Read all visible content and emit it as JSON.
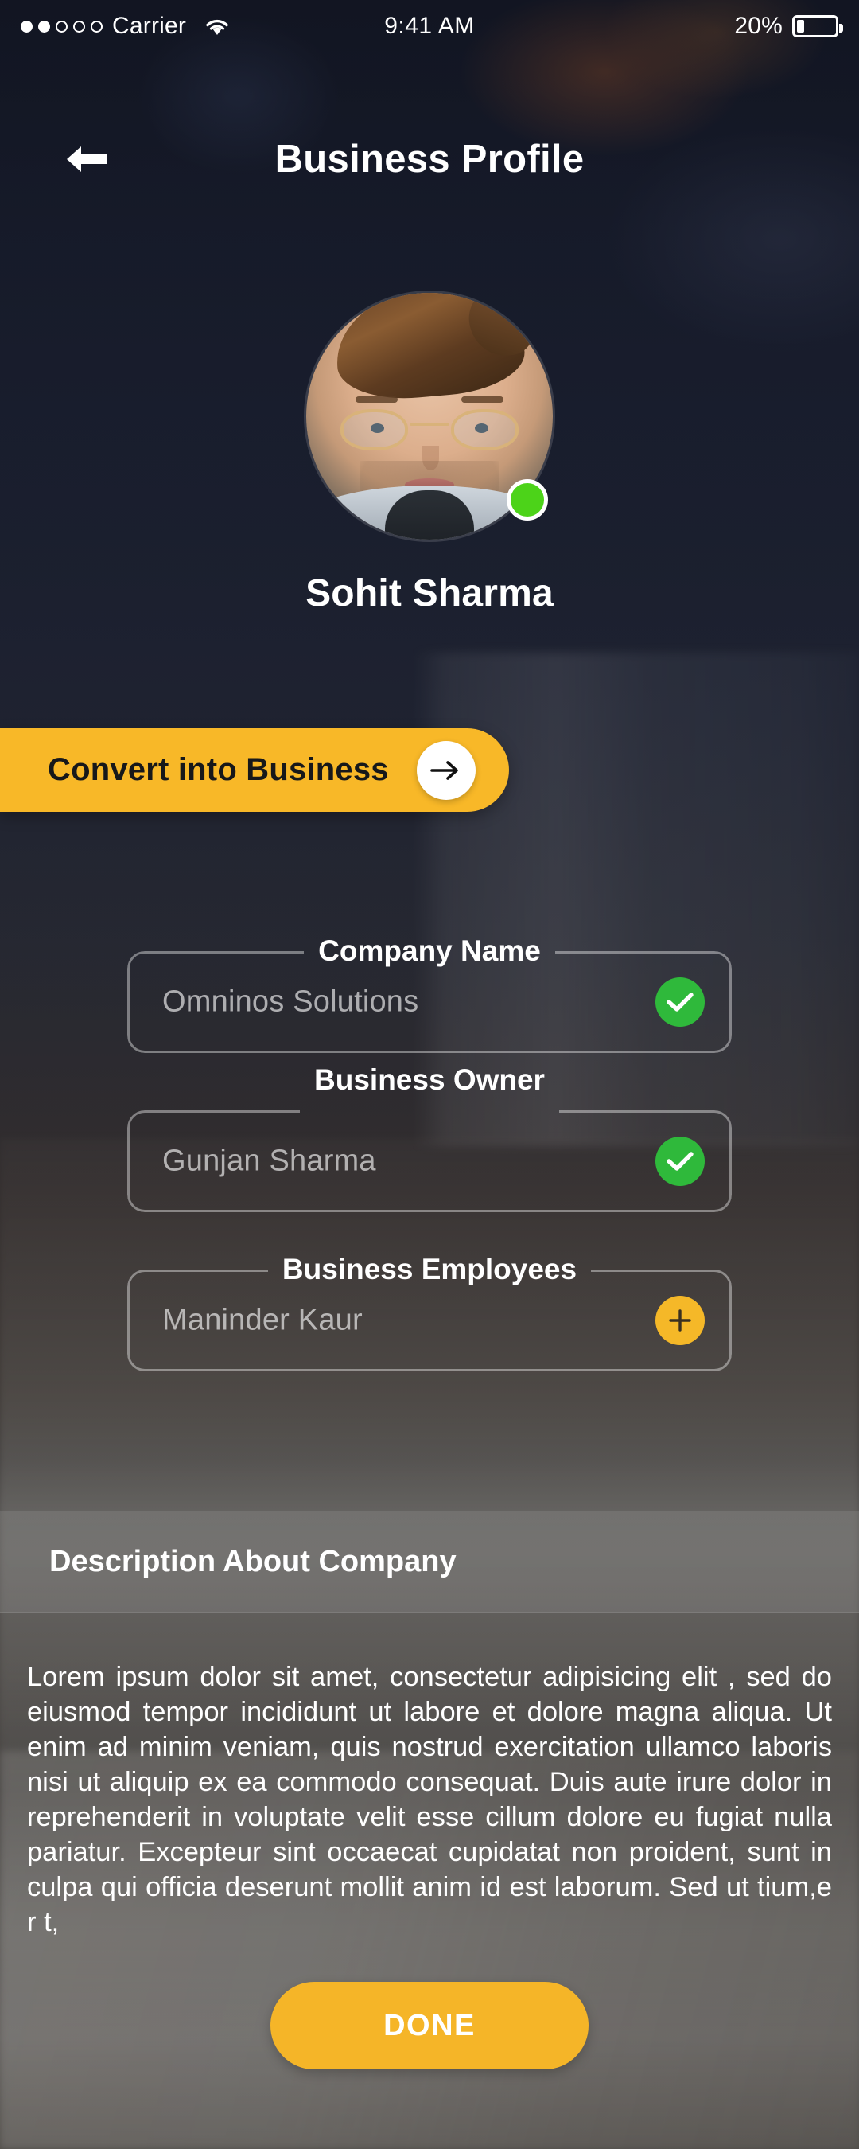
{
  "status_bar": {
    "carrier": "Carrier",
    "signal_dots_filled": 2,
    "signal_dots_total": 5,
    "wifi_icon": "wifi-icon",
    "time": "9:41 AM",
    "battery_percent": "20%",
    "battery_level": 20
  },
  "header": {
    "back_icon": "arrow-left-icon",
    "title": "Business Profile"
  },
  "profile": {
    "avatar_alt": "avatar",
    "online_status": "online",
    "name": "Sohit Sharma"
  },
  "convert_button": {
    "label": "Convert into Business",
    "arrow_icon": "arrow-right-icon"
  },
  "form": {
    "fields": [
      {
        "label": "Company Name",
        "value": "Omninos Solutions",
        "action_icon": "check-icon",
        "action_type": "check"
      },
      {
        "label": "Business Owner",
        "value": "Gunjan Sharma",
        "action_icon": "check-icon",
        "action_type": "check"
      },
      {
        "label": "Business Employees",
        "value": "Maninder Kaur",
        "action_icon": "plus-icon",
        "action_type": "plus"
      }
    ]
  },
  "description": {
    "heading": "Description About Company",
    "body": "Lorem ipsum dolor sit amet, consectetur adipisicing elit , sed do eiusmod tempor incididunt ut labore et dolore magna aliqua. Ut enim ad minim veniam, quis nostrud exercitation ullamco laboris nisi ut aliquip ex ea commodo consequat. Duis aute irure dolor in reprehenderit in voluptate velit esse cillum dolore eu fugiat nulla pariatur. Excepteur sint occaecat cupidatat non proident, sunt in culpa qui officia deserunt mollit anim id est laborum. Sed ut tium,e r t,"
  },
  "done_button": {
    "label": "DONE"
  },
  "colors": {
    "accent_yellow": "#f5b528",
    "convert_yellow": "#f8b828",
    "status_green": "#4cd319",
    "check_green": "#2fb93b",
    "text_white": "#ffffff",
    "field_border": "rgba(255,255,255,0.40)"
  }
}
